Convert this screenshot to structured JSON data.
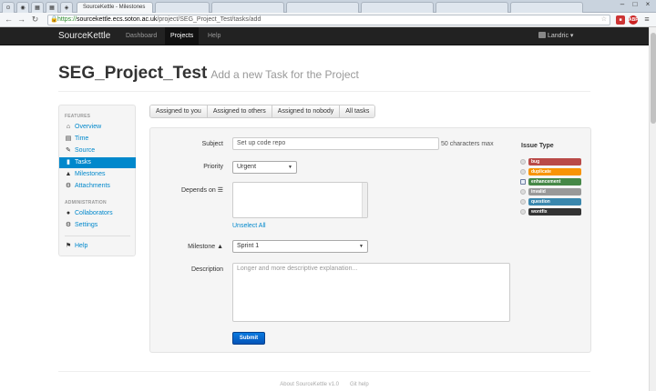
{
  "browser": {
    "tabs": [
      {
        "label": ""
      },
      {
        "label": ""
      },
      {
        "label": ""
      },
      {
        "label": "SourceKettle - Milestones"
      },
      {
        "label": ""
      },
      {
        "label": ""
      },
      {
        "label": ""
      }
    ],
    "url_scheme": "https://",
    "url_host": "sourcekettle.ecs.soton.ac.uk",
    "url_path": "/project/SEG_Project_Test/tasks/add",
    "ext_badge": "ABP"
  },
  "navbar": {
    "brand": "SourceKettle",
    "links": [
      "Dashboard",
      "Projects",
      "Help"
    ],
    "user": "Landric"
  },
  "page": {
    "title": "SEG_Project_Test",
    "subtitle": "Add a new Task for the Project"
  },
  "sidebar": {
    "features_header": "FEATURES",
    "features": [
      {
        "label": "Overview",
        "icon": "home-icon",
        "glyph": "⌂"
      },
      {
        "label": "Time",
        "icon": "calendar-icon",
        "glyph": "▤"
      },
      {
        "label": "Source",
        "icon": "pencil-icon",
        "glyph": "✎"
      },
      {
        "label": "Tasks",
        "icon": "file-icon",
        "glyph": "▮"
      },
      {
        "label": "Milestones",
        "icon": "road-icon",
        "glyph": "▲"
      },
      {
        "label": "Attachments",
        "icon": "gear-icon",
        "glyph": "⚙"
      }
    ],
    "admin_header": "ADMINISTRATION",
    "admin": [
      {
        "label": "Collaborators",
        "icon": "user-icon",
        "glyph": "●"
      },
      {
        "label": "Settings",
        "icon": "cog-icon",
        "glyph": "⚙"
      }
    ],
    "help": {
      "label": "Help",
      "icon": "flag-icon",
      "glyph": "⚑"
    }
  },
  "filters": [
    "Assigned to you",
    "Assigned to others",
    "Assigned to nobody",
    "All tasks"
  ],
  "form": {
    "subject_label": "Subject",
    "subject_value": "Set up code repo",
    "subject_help": "50 characters max",
    "priority_label": "Priority",
    "priority_value": "Urgent",
    "depends_label": "Depends on",
    "unselect_all": "Unselect All",
    "milestone_label": "Milestone",
    "milestone_value": "Sprint 1",
    "description_label": "Description",
    "description_placeholder": "Longer and more descriptive explanation...",
    "submit": "Submit"
  },
  "issue_types": {
    "title": "Issue Type",
    "items": [
      {
        "label": "bug",
        "color": "#b94a48",
        "checked": false
      },
      {
        "label": "duplicate",
        "color": "#f89406",
        "checked": false
      },
      {
        "label": "enhancement",
        "color": "#468847",
        "checked": true
      },
      {
        "label": "invalid",
        "color": "#999999",
        "checked": false
      },
      {
        "label": "question",
        "color": "#3a87ad",
        "checked": false
      },
      {
        "label": "wontfix",
        "color": "#333333",
        "checked": false
      }
    ]
  },
  "footer": {
    "about": "About SourceKettle v1.0",
    "git_help": "Git help"
  }
}
